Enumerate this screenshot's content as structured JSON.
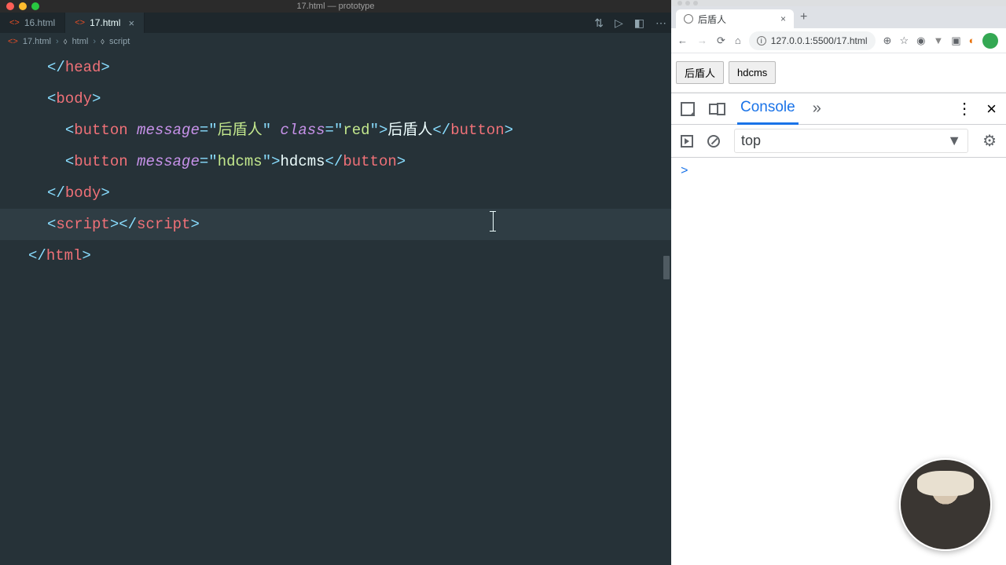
{
  "window": {
    "title": "17.html — prototype"
  },
  "tabs": [
    {
      "label": "16.html",
      "active": false
    },
    {
      "label": "17.html",
      "active": true
    }
  ],
  "breadcrumb": {
    "a": "17.html",
    "b": "html",
    "c": "script"
  },
  "code": {
    "l1": {
      "p1": "</",
      "tag": "head",
      "p2": ">"
    },
    "l2": {
      "p1": "<",
      "tag": "body",
      "p2": ">"
    },
    "l3": {
      "p1": "<",
      "tag": "button",
      "sp": " ",
      "at1": "message",
      "eq": "=",
      "q": "\"",
      "v1": "后盾人",
      "at2": "class",
      "v2": "red",
      "p2": ">",
      "txt": "后盾人",
      "p3": "</",
      "p4": ">"
    },
    "l4": {
      "p1": "<",
      "tag": "button",
      "sp": " ",
      "at1": "message",
      "eq": "=",
      "q": "\"",
      "v1": "hdcms",
      "p2": ">",
      "txt": "hdcms",
      "p3": "</",
      "p4": ">"
    },
    "l5": {
      "p1": "</",
      "tag": "body",
      "p2": ">"
    },
    "l6": {
      "p1": "<",
      "tag": "script",
      "p2": "></",
      "p3": ">"
    },
    "l7": {
      "p1": "</",
      "tag": "html",
      "p2": ">"
    }
  },
  "browser": {
    "tab_title": "后盾人",
    "url": "127.0.0.1:5500/17.html",
    "buttons": {
      "b1": "后盾人",
      "b2": "hdcms"
    }
  },
  "devtools": {
    "tab": "Console",
    "context": "top",
    "prompt": ">"
  }
}
